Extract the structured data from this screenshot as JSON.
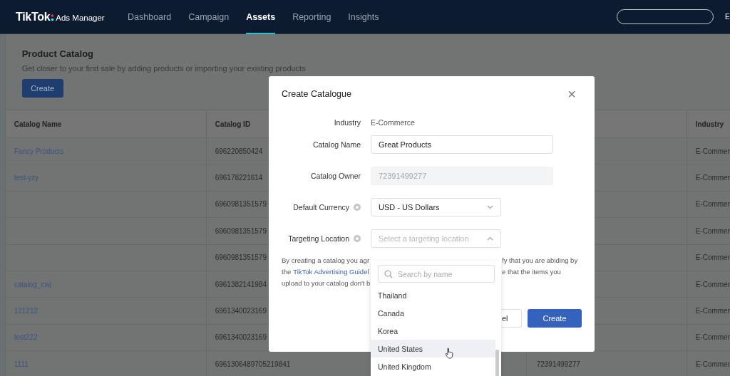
{
  "nav": {
    "logo": "TikTok",
    "product": "Ads Manager",
    "items": [
      {
        "label": "Dashboard",
        "selected": false
      },
      {
        "label": "Campaign",
        "selected": false
      },
      {
        "label": "Assets",
        "selected": true
      },
      {
        "label": "Reporting",
        "selected": false
      },
      {
        "label": "Insights",
        "selected": false
      }
    ],
    "account_initial": "E"
  },
  "page": {
    "title": "Product Catalog",
    "subtitle": "Get closer to your first sale by adding products or importing your existing products",
    "create_button": "Create"
  },
  "table": {
    "columns": [
      "Catalog Name",
      "Catalog ID",
      "Industry"
    ],
    "rows": [
      {
        "name": "Fancy Products",
        "id": "696220850424",
        "industry": "E-Commer"
      },
      {
        "name": "test-yzy",
        "id": "696178221614",
        "industry": "E-Commer"
      },
      {
        "id": "6960981351579",
        "industry": "E-Commer"
      },
      {
        "id": "6960981351579",
        "industry": "E-Commer"
      },
      {
        "id": "6960981351579",
        "industry": "E-Commer"
      },
      {
        "name": "catalog_cwj",
        "id": "6961382141984",
        "industry": "E-Commer"
      },
      {
        "name": "121212",
        "id": "6961340023169",
        "industry": "E-Commer"
      },
      {
        "name": "test222",
        "id": "6961340023169",
        "industry": "E-Commer"
      },
      {
        "name": "1111",
        "id": "6961306489705219841",
        "owner": "72391499277",
        "industry": "E-Commer"
      }
    ]
  },
  "modal": {
    "title": "Create Catalogue",
    "close": "×",
    "fields": [
      {
        "kind": "text",
        "label": "Industry",
        "value": "E-Commerce"
      },
      {
        "kind": "input",
        "label": "Catalog Name",
        "value": "Great Products"
      },
      {
        "kind": "disabled",
        "label": "Catalog Owner",
        "placeholder": "72391499277"
      },
      {
        "kind": "select",
        "label": "Default Currency",
        "help": true,
        "value": "USD - US Dollars",
        "expanded": false
      },
      {
        "kind": "select",
        "label": "Targeting Location",
        "help": true,
        "placeholder": "Select a targeting location",
        "expanded": true
      }
    ],
    "notice_left": [
      {
        "text": "By creating a catalog you agr"
      },
      {
        "text": "the",
        "link": "TikTok Advertising Guidel"
      },
      {
        "text": "upload to your catalog don't b"
      }
    ],
    "notice_right": [
      "fy that you are abiding by",
      "e that the items you"
    ],
    "cancel_button": "el",
    "create_button": "Create"
  },
  "dropdown": {
    "search_placeholder": "Search by name",
    "options": [
      {
        "label": "Thailand",
        "hovered": false
      },
      {
        "label": "Canada",
        "hovered": false
      },
      {
        "label": "Korea",
        "hovered": false
      },
      {
        "label": "United States",
        "hovered": true
      },
      {
        "label": "United Kingdom",
        "hovered": false
      }
    ]
  }
}
